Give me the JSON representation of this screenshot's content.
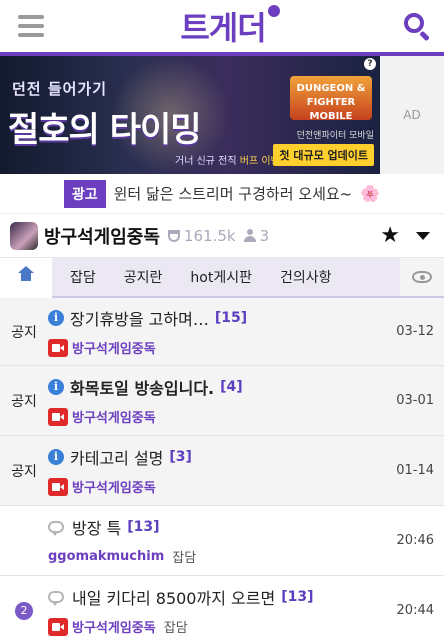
{
  "header": {
    "logo": "트게더",
    "menu_icon": "hamburger-menu-icon",
    "search_icon": "search-icon"
  },
  "ad": {
    "line1": "던전 들어가기",
    "line2a": "절호의 ",
    "line2b": "타이밍",
    "line3a": "거너 신규 전직 ",
    "line3b": "버프 이벤트",
    "brand": "DUNGEON & FIGHTER MOBILE",
    "sub": "던전앤파이터 모바일",
    "update": "첫 대규모 업데이트",
    "side_label": "AD"
  },
  "promo": {
    "tag": "광고",
    "text": "윈터 닮은 스트리머 구경하러 오세요~",
    "emoji": "🌸"
  },
  "channel": {
    "name": "방구석게임중독",
    "followers": "161.5k",
    "viewers": "3"
  },
  "tabs": [
    "잡담",
    "공지란",
    "hot게시판",
    "건의사항"
  ],
  "posts": [
    {
      "lead": "공지",
      "type": "notice",
      "title": "장기휴방을 고하며…",
      "count": "[15]",
      "author": "방구석게임중독",
      "category": "",
      "time": "03-12",
      "bold": false
    },
    {
      "lead": "공지",
      "type": "notice",
      "title": "화목토일 방송입니다.",
      "count": "[4]",
      "author": "방구석게임중독",
      "category": "",
      "time": "03-01",
      "bold": true
    },
    {
      "lead": "공지",
      "type": "notice",
      "title": "카테고리 설명",
      "count": "[3]",
      "author": "방구석게임중독",
      "category": "",
      "time": "01-14",
      "bold": false
    },
    {
      "lead": "",
      "type": "post",
      "title": "방장 특",
      "count": "[13]",
      "author": "ggomakmuchim",
      "category": "잡담",
      "time": "20:46",
      "bold": false
    },
    {
      "lead": "2",
      "type": "post",
      "title": "내일 키다리 8500까지 오르면",
      "count": "[13]",
      "author": "방구석게임중독",
      "category": "잡담",
      "time": "20:44",
      "bold": false
    }
  ],
  "colors": {
    "brand": "#6b3fbf",
    "notice_bg": "#f4f4f4",
    "info_blue": "#3a80d9",
    "cam_red": "#e02a2a"
  }
}
